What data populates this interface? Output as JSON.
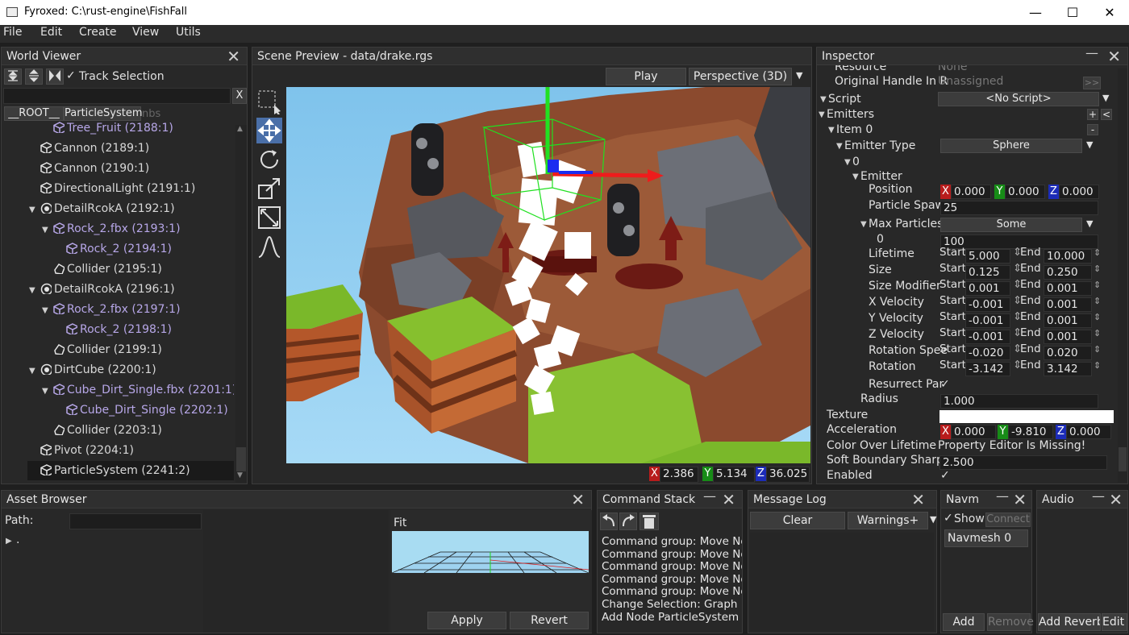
{
  "window": {
    "title": "Fyroxed: C:\\rust-engine\\FishFall",
    "minimize": "—",
    "maximize": "☐",
    "close": "✕"
  },
  "menu": [
    "File",
    "Edit",
    "Create",
    "View",
    "Utils"
  ],
  "world_viewer": {
    "title": "World Viewer",
    "track_selection": "Track Selection",
    "search_clear": "X",
    "breadcrumbs": [
      "__ROOT__",
      "ParticleSystem"
    ],
    "crumb_ghost": "nbs",
    "nodes": [
      {
        "label": "Tree_Fruit (2188:1)",
        "indent": 64,
        "icon": "cube",
        "color": "purple"
      },
      {
        "label": "Cannon (2189:1)",
        "indent": 48,
        "icon": "cube",
        "color": "white"
      },
      {
        "label": "Cannon (2190:1)",
        "indent": 48,
        "icon": "cube",
        "color": "white"
      },
      {
        "label": "DirectionalLight (2191:1)",
        "indent": 48,
        "icon": "cube",
        "color": "white"
      },
      {
        "label": "DetailRcokA (2192:1)",
        "indent": 48,
        "icon": "target",
        "color": "white",
        "expand": true
      },
      {
        "label": "Rock_2.fbx (2193:1)",
        "indent": 64,
        "icon": "cube",
        "color": "purple",
        "expand": true
      },
      {
        "label": "Rock_2 (2194:1)",
        "indent": 80,
        "icon": "cube",
        "color": "purple"
      },
      {
        "label": "Collider (2195:1)",
        "indent": 64,
        "icon": "shape",
        "color": "white"
      },
      {
        "label": "DetailRcokA (2196:1)",
        "indent": 48,
        "icon": "target",
        "color": "white",
        "expand": true
      },
      {
        "label": "Rock_2.fbx (2197:1)",
        "indent": 64,
        "icon": "cube",
        "color": "purple",
        "expand": true
      },
      {
        "label": "Rock_2 (2198:1)",
        "indent": 80,
        "icon": "cube",
        "color": "purple"
      },
      {
        "label": "Collider (2199:1)",
        "indent": 64,
        "icon": "shape",
        "color": "white"
      },
      {
        "label": "DirtCube (2200:1)",
        "indent": 48,
        "icon": "target",
        "color": "white",
        "expand": true
      },
      {
        "label": "Cube_Dirt_Single.fbx (2201:1)",
        "indent": 64,
        "icon": "cube",
        "color": "purple",
        "expand": true
      },
      {
        "label": "Cube_Dirt_Single (2202:1)",
        "indent": 80,
        "icon": "cube",
        "color": "purple"
      },
      {
        "label": "Collider (2203:1)",
        "indent": 64,
        "icon": "shape",
        "color": "white"
      },
      {
        "label": "Pivot (2204:1)",
        "indent": 48,
        "icon": "cube",
        "color": "white"
      },
      {
        "label": "ParticleSystem (2241:2)",
        "indent": 48,
        "icon": "cube",
        "color": "white",
        "selected": true
      }
    ]
  },
  "scene_preview": {
    "title": "Scene Preview - data/drake.rgs",
    "play": "Play",
    "camera_mode": "Perspective (3D)",
    "coords": {
      "x_label": "X",
      "x": "2.386",
      "y_label": "Y",
      "y": "5.134",
      "z_label": "Z",
      "z": "36.025"
    }
  },
  "inspector": {
    "title": "Inspector",
    "resource_label": "Resource",
    "resource_value": "None",
    "orig_handle_label": "Original Handle In R",
    "orig_handle_value": "Unassigned",
    "orig_handle_btn": ">>",
    "script_label": "Script",
    "script_value": "<No Script>",
    "emitters_label": "Emitters",
    "item0_label": "Item 0",
    "emitter_type_label": "Emitter Type",
    "emitter_type_value": "Sphere",
    "zero_label": "0",
    "emitter_label": "Emitter",
    "position_label": "Position",
    "position": {
      "x": "0.000",
      "y": "0.000",
      "z": "0.000"
    },
    "spawn_label": "Particle Spaw",
    "spawn_value": "25",
    "max_particles_label": "Max Particles",
    "max_particles_value": "Some",
    "max_zero_label": "0",
    "max_zero_value": "100",
    "start": "Start",
    "end": "End",
    "ranges": [
      {
        "label": "Lifetime",
        "start": "5.000",
        "end": "10.000"
      },
      {
        "label": "Size",
        "start": "0.125",
        "end": "0.250"
      },
      {
        "label": "Size Modifier",
        "start": "0.001",
        "end": "0.001"
      },
      {
        "label": "X Velocity",
        "start": "-0.001",
        "end": "0.001"
      },
      {
        "label": "Y Velocity",
        "start": "-0.001",
        "end": "0.001"
      },
      {
        "label": "Z Velocity",
        "start": "-0.001",
        "end": "0.001"
      },
      {
        "label": "Rotation Spee",
        "start": "-0.020",
        "end": "0.020"
      },
      {
        "label": "Rotation",
        "start": "-3.142",
        "end": "3.142"
      }
    ],
    "resurrect_label": "Resurrect Par",
    "resurrect_check": "✓",
    "radius_label": "Radius",
    "radius_value": "1.000",
    "texture_label": "Texture",
    "accel_label": "Acceleration",
    "accel": {
      "x": "0.000",
      "y": "-9.810",
      "z": "0.000"
    },
    "color_label": "Color Over Lifetime",
    "color_value": "Property Editor Is Missing!",
    "soft_label": "Soft Boundary Sharpn",
    "soft_value": "2.500",
    "enabled_label": "Enabled",
    "enabled_check": "✓",
    "plus": "+",
    "arrow": "<",
    "minus": "-"
  },
  "asset_browser": {
    "title": "Asset Browser",
    "path_label": "Path:",
    "root": ".",
    "fit": "Fit",
    "apply": "Apply",
    "revert": "Revert"
  },
  "command_stack": {
    "title": "Command Stack",
    "entries": [
      "Command group: Move No",
      "Command group: Move No",
      "Command group: Move No",
      "Command group: Move No",
      "Command group: Move No",
      "Change Selection: Graph",
      "Add Node ParticleSystem"
    ]
  },
  "message_log": {
    "title": "Message Log",
    "clear": "Clear",
    "filter": "Warnings+"
  },
  "navmesh": {
    "title": "Navm",
    "show": "Show",
    "connect": "Connect",
    "item": "Navmesh 0",
    "add": "Add",
    "remove": "Remove"
  },
  "audio": {
    "title": "Audio",
    "add_reverb": "Add Reverb",
    "edit": "Edit C"
  }
}
